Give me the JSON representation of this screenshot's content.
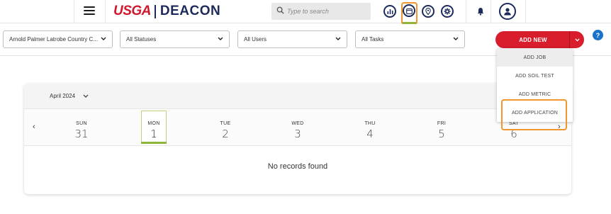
{
  "header": {
    "brand_primary": "USGA",
    "brand_secondary": "DEACON",
    "search_placeholder": "Type to search",
    "icons": [
      "menu-icon",
      "chart-icon",
      "calendar-icon",
      "location-icon",
      "gear-icon",
      "bell-icon",
      "user-icon"
    ],
    "colors": {
      "brand_red": "#d1172c",
      "brand_navy": "#1d2b5c",
      "highlight_orange": "#f0962f",
      "active_green": "#8fb63a"
    }
  },
  "filters": {
    "course": "Arnold Palmer Latrobe Country C...",
    "status": "All Statuses",
    "users": "All Users",
    "tasks": "All Tasks"
  },
  "actions": {
    "add_new_label": "ADD NEW",
    "help_label": "?",
    "add_menu": [
      "ADD JOB",
      "ADD SOIL TEST",
      "ADD METRIC",
      "ADD APPLICATION"
    ]
  },
  "calendar": {
    "month_label": "April 2024",
    "days": [
      {
        "name": "SUN",
        "date": "31"
      },
      {
        "name": "MON",
        "date": "1"
      },
      {
        "name": "TUE",
        "date": "2"
      },
      {
        "name": "WED",
        "date": "3"
      },
      {
        "name": "THU",
        "date": "4"
      },
      {
        "name": "FRI",
        "date": "5"
      },
      {
        "name": "SAT",
        "date": "6"
      }
    ],
    "selected_day": "MON",
    "prev_arrow": "‹",
    "next_arrow": "›",
    "empty_message": "No records found"
  }
}
